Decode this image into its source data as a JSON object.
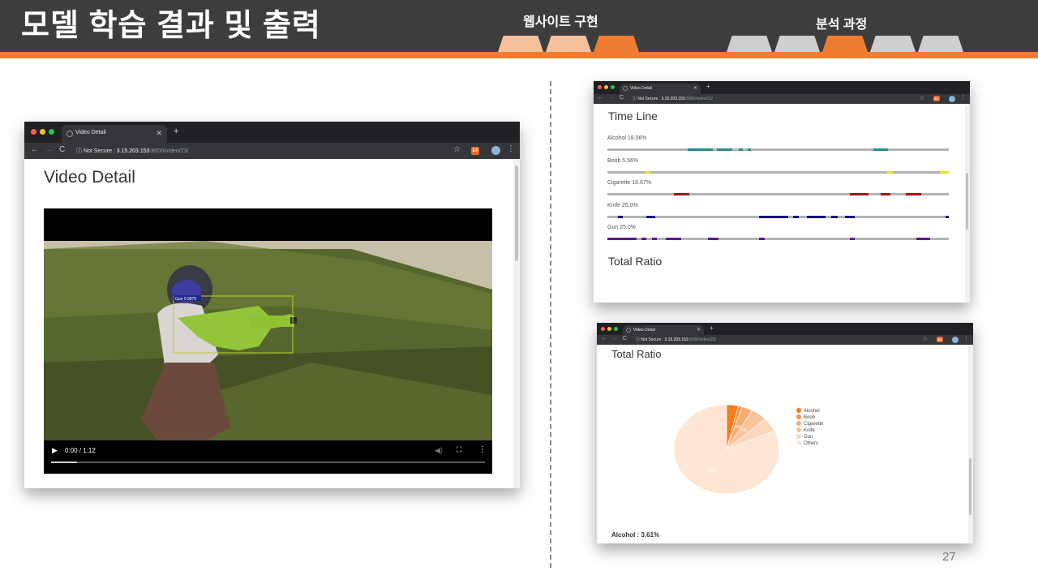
{
  "slide": {
    "title": "모델 학습 결과 및 출력",
    "section_website": "웹사이트 구현",
    "section_analysis": "분석 과정",
    "page_number": "27"
  },
  "browser": {
    "tab_title": "Video Detail",
    "not_secure": "Not Secure",
    "url_host": "3.15.203.153",
    "url_path": ":8000/video/23/",
    "ext_label": "EX"
  },
  "video_detail": {
    "heading": "Video Detail",
    "time_display": "0:00 / 1:12",
    "detection_label": "Gun 0.9875",
    "progress_fraction": 0.06
  },
  "timeline": {
    "heading": "Time Line",
    "total_ratio_heading": "Total Ratio",
    "rows": [
      {
        "label": "Alcohol 18.06%",
        "color": "#2a8a86",
        "segments": [
          [
            0.235,
            0.075
          ],
          [
            0.32,
            0.045
          ],
          [
            0.385,
            0.012
          ],
          [
            0.41,
            0.01
          ],
          [
            0.78,
            0.042
          ]
        ]
      },
      {
        "label": "Boob 5.56%",
        "color": "#e8e02a",
        "segments": [
          [
            0.11,
            0.015
          ],
          [
            0.82,
            0.015
          ],
          [
            0.975,
            0.025
          ]
        ]
      },
      {
        "label": "Cigarette 16.67%",
        "color": "#9b1a1a",
        "segments": [
          [
            0.195,
            0.045
          ],
          [
            0.71,
            0.055
          ],
          [
            0.8,
            0.03
          ],
          [
            0.875,
            0.045
          ]
        ]
      },
      {
        "label": "Knife 25.0%",
        "color": "#15137a",
        "segments": [
          [
            0.03,
            0.015
          ],
          [
            0.115,
            0.025
          ],
          [
            0.445,
            0.085
          ],
          [
            0.545,
            0.015
          ],
          [
            0.585,
            0.055
          ],
          [
            0.655,
            0.02
          ],
          [
            0.695,
            0.03
          ],
          [
            0.99,
            0.01
          ]
        ]
      },
      {
        "label": "Gun 25.0%",
        "color": "#5b1a8c",
        "segments": [
          [
            0.0,
            0.085
          ],
          [
            0.1,
            0.015
          ],
          [
            0.13,
            0.015
          ],
          [
            0.17,
            0.045
          ],
          [
            0.295,
            0.03
          ],
          [
            0.445,
            0.015
          ],
          [
            0.71,
            0.015
          ],
          [
            0.905,
            0.04
          ]
        ]
      }
    ]
  },
  "ratio": {
    "heading": "Total Ratio",
    "footer": "Alcohol : 3.61%",
    "slice_labels": [
      "4%",
      "5%",
      "80%"
    ],
    "chart_data": {
      "type": "pie",
      "categories": [
        "Alcohol",
        "Boob",
        "Cigarette",
        "Knife",
        "Gun",
        "Others"
      ],
      "values": [
        3.61,
        1.11,
        3.33,
        5.0,
        5.0,
        81.95
      ],
      "colors": [
        "#f57d1f",
        "#f7954a",
        "#f8ad73",
        "#fac49b",
        "#fcd7bc",
        "#fde6d3"
      ]
    }
  }
}
